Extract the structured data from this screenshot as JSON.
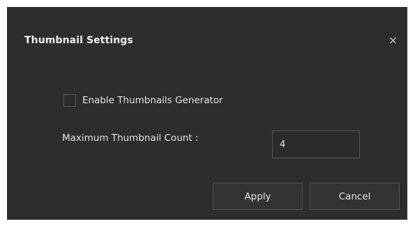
{
  "dialog": {
    "title": "Thumbnail Settings",
    "close_glyph": "×",
    "close_icon": "close-icon",
    "enable_label": "Enable Thumbnails Generator",
    "enable_checked": false,
    "max_count_label": "Maximum Thumbnail Count :",
    "max_count_value": "4",
    "apply_label": "Apply",
    "cancel_label": "Cancel"
  },
  "colors": {
    "dialog_background": "#2d2d2d",
    "text": "#e6e6e6",
    "border": "#585858"
  }
}
